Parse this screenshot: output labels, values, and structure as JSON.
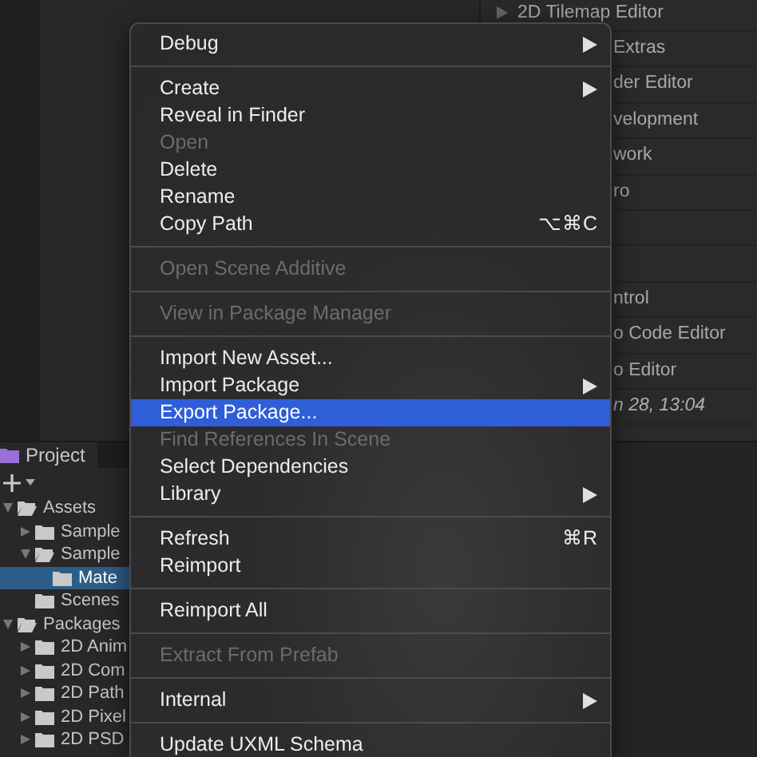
{
  "inspector_list": {
    "rows": [
      {
        "kind": "package",
        "label": "2D Tilemap Editor"
      },
      {
        "kind": "fragment",
        "label": "Extras"
      },
      {
        "kind": "fragment",
        "label": "der Editor"
      },
      {
        "kind": "fragment",
        "label": "velopment"
      },
      {
        "kind": "fragment",
        "label": "work"
      },
      {
        "kind": "fragment",
        "label": "ro"
      },
      {
        "kind": "empty"
      },
      {
        "kind": "empty"
      },
      {
        "kind": "fragment",
        "label": "ntrol"
      },
      {
        "kind": "fragment",
        "label": "o Code Editor"
      },
      {
        "kind": "fragment",
        "label": "o Editor"
      },
      {
        "kind": "date",
        "label": "n 28, 13:04"
      }
    ]
  },
  "project_panel": {
    "tab": {
      "label": "Project"
    },
    "tree": [
      {
        "label": "Assets",
        "expanded": true,
        "selected": false,
        "children": [
          {
            "label": "Sample",
            "expanded": false,
            "selected": false
          },
          {
            "label": "Sample",
            "expanded": true,
            "selected": false,
            "children": [
              {
                "label": "Mate",
                "selected": true
              }
            ]
          },
          {
            "label": "Scenes",
            "selected": false
          }
        ]
      },
      {
        "label": "Packages",
        "expanded": true,
        "selected": false,
        "children": [
          {
            "label": "2D Anim",
            "expanded": false,
            "selected": false
          },
          {
            "label": "2D Com",
            "expanded": false,
            "selected": false
          },
          {
            "label": "2D Path",
            "expanded": false,
            "selected": false
          },
          {
            "label": "2D Pixel",
            "expanded": false,
            "selected": false
          },
          {
            "label": "2D PSD",
            "expanded": false,
            "selected": false
          }
        ]
      }
    ]
  },
  "context_menu": {
    "items": [
      {
        "kind": "item",
        "label": "Debug",
        "disabled": false,
        "selected": false,
        "submenu": true
      },
      {
        "kind": "separator"
      },
      {
        "kind": "item",
        "label": "Create",
        "disabled": false,
        "selected": false,
        "submenu": true
      },
      {
        "kind": "item",
        "label": "Reveal in Finder",
        "disabled": false,
        "selected": false,
        "submenu": false
      },
      {
        "kind": "item",
        "label": "Open",
        "disabled": true,
        "selected": false,
        "submenu": false
      },
      {
        "kind": "item",
        "label": "Delete",
        "disabled": false,
        "selected": false,
        "submenu": false
      },
      {
        "kind": "item",
        "label": "Rename",
        "disabled": false,
        "selected": false,
        "submenu": false
      },
      {
        "kind": "item",
        "label": "Copy Path",
        "disabled": false,
        "selected": false,
        "submenu": false,
        "shortcut": "⌥⌘C"
      },
      {
        "kind": "separator"
      },
      {
        "kind": "item",
        "label": "Open Scene Additive",
        "disabled": true,
        "selected": false,
        "submenu": false
      },
      {
        "kind": "separator"
      },
      {
        "kind": "item",
        "label": "View in Package Manager",
        "disabled": true,
        "selected": false,
        "submenu": false
      },
      {
        "kind": "separator"
      },
      {
        "kind": "item",
        "label": "Import New Asset...",
        "disabled": false,
        "selected": false,
        "submenu": false
      },
      {
        "kind": "item",
        "label": "Import Package",
        "disabled": false,
        "selected": false,
        "submenu": true
      },
      {
        "kind": "item",
        "label": "Export Package...",
        "disabled": false,
        "selected": true,
        "submenu": false
      },
      {
        "kind": "item",
        "label": "Find References In Scene",
        "disabled": true,
        "selected": false,
        "submenu": false
      },
      {
        "kind": "item",
        "label": "Select Dependencies",
        "disabled": false,
        "selected": false,
        "submenu": false
      },
      {
        "kind": "item",
        "label": "Library",
        "disabled": false,
        "selected": false,
        "submenu": true
      },
      {
        "kind": "separator"
      },
      {
        "kind": "item",
        "label": "Refresh",
        "disabled": false,
        "selected": false,
        "submenu": false,
        "shortcut": "⌘R"
      },
      {
        "kind": "item",
        "label": "Reimport",
        "disabled": false,
        "selected": false,
        "submenu": false
      },
      {
        "kind": "separator"
      },
      {
        "kind": "item",
        "label": "Reimport All",
        "disabled": false,
        "selected": false,
        "submenu": false
      },
      {
        "kind": "separator"
      },
      {
        "kind": "item",
        "label": "Extract From Prefab",
        "disabled": true,
        "selected": false,
        "submenu": false
      },
      {
        "kind": "separator"
      },
      {
        "kind": "item",
        "label": "Internal",
        "disabled": false,
        "selected": false,
        "submenu": true
      },
      {
        "kind": "separator"
      },
      {
        "kind": "item",
        "label": "Update UXML Schema",
        "disabled": false,
        "selected": false,
        "submenu": false
      }
    ]
  }
}
